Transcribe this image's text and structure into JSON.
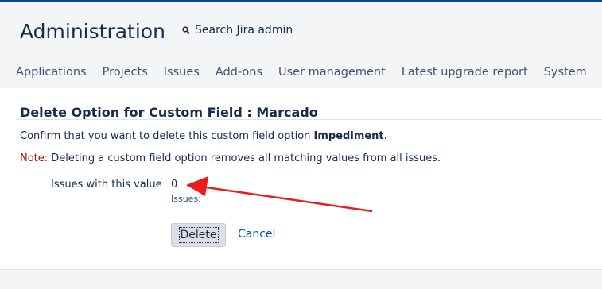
{
  "header": {
    "title": "Administration",
    "search_label": "Search Jira admin",
    "nav": [
      "Applications",
      "Projects",
      "Issues",
      "Add-ons",
      "User management",
      "Latest upgrade report",
      "System"
    ]
  },
  "form": {
    "title": "Delete Option for Custom Field : Marcado",
    "confirm_prefix": "Confirm that you want to delete this custom field option ",
    "option_name": "Impediment",
    "confirm_suffix": ".",
    "note_label": "Note:",
    "note_text": " Deleting a custom field option removes all matching values from all issues.",
    "field_label": "Issues with this value",
    "field_value": "0",
    "field_desc": "Issues:",
    "delete_label": "Delete",
    "cancel_label": "Cancel"
  },
  "colors": {
    "accent": "#0052cc",
    "note": "#a0171a",
    "annotation_arrow": "#e81e1e"
  }
}
